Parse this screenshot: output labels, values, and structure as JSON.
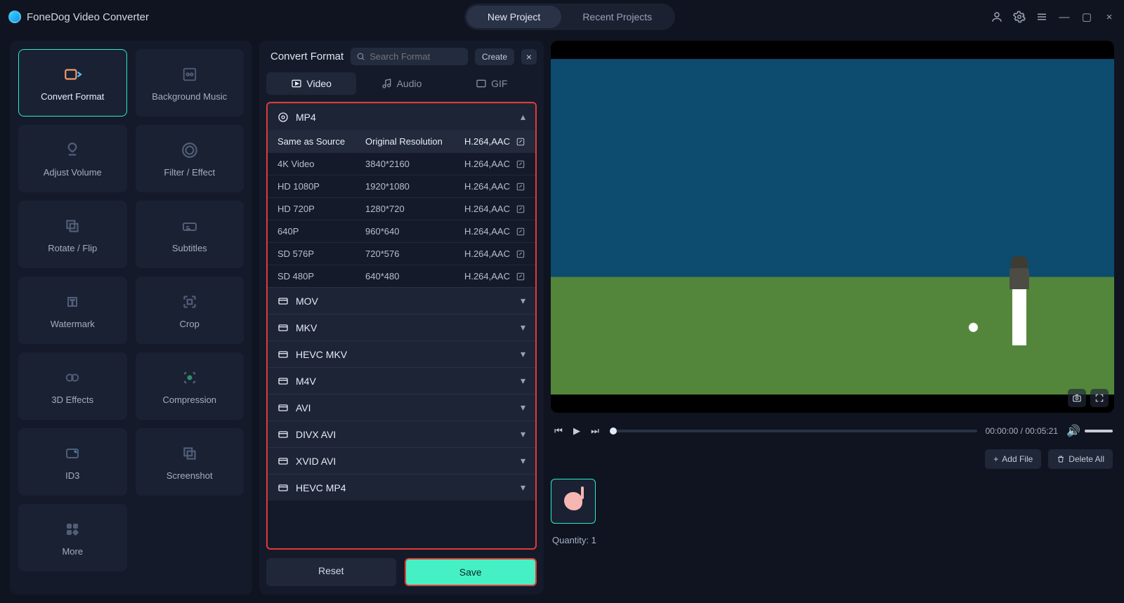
{
  "app_title": "FoneDog Video Converter",
  "top_tabs": {
    "new": "New Project",
    "recent": "Recent Projects"
  },
  "sidebar_tools": [
    {
      "name": "Convert Format",
      "active": true
    },
    {
      "name": "Background Music"
    },
    {
      "name": "Adjust Volume"
    },
    {
      "name": "Filter / Effect"
    },
    {
      "name": "Rotate / Flip"
    },
    {
      "name": "Subtitles"
    },
    {
      "name": "Watermark"
    },
    {
      "name": "Crop"
    },
    {
      "name": "3D Effects"
    },
    {
      "name": "Compression"
    },
    {
      "name": "ID3"
    },
    {
      "name": "Screenshot"
    },
    {
      "name": "More"
    }
  ],
  "format_panel": {
    "title": "Convert Format",
    "search_placeholder": "Search Format",
    "create_label": "Create",
    "tabs": {
      "video": "Video",
      "audio": "Audio",
      "gif": "GIF"
    },
    "active_format": "MP4",
    "presets": [
      {
        "name": "Same as Source",
        "res": "Original Resolution",
        "codec": "H.264,AAC",
        "sel": true
      },
      {
        "name": "4K Video",
        "res": "3840*2160",
        "codec": "H.264,AAC"
      },
      {
        "name": "HD 1080P",
        "res": "1920*1080",
        "codec": "H.264,AAC"
      },
      {
        "name": "HD 720P",
        "res": "1280*720",
        "codec": "H.264,AAC"
      },
      {
        "name": "640P",
        "res": "960*640",
        "codec": "H.264,AAC"
      },
      {
        "name": "SD 576P",
        "res": "720*576",
        "codec": "H.264,AAC"
      },
      {
        "name": "SD 480P",
        "res": "640*480",
        "codec": "H.264,AAC"
      }
    ],
    "groups": [
      "MOV",
      "MKV",
      "HEVC MKV",
      "M4V",
      "AVI",
      "DIVX AVI",
      "XVID AVI",
      "HEVC MP4"
    ],
    "reset_label": "Reset",
    "save_label": "Save"
  },
  "player": {
    "time_current": "00:00:00",
    "time_total": "00:05:21"
  },
  "file_bar": {
    "add_label": "Add File",
    "delete_all_label": "Delete All"
  },
  "quantity_label": "Quantity: 1"
}
